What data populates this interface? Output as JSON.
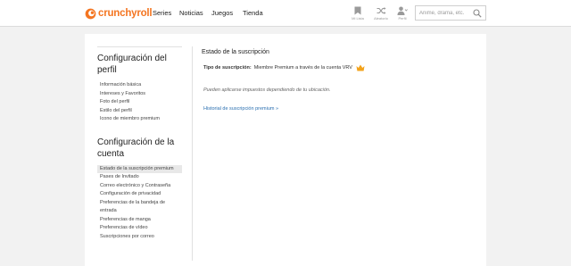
{
  "header": {
    "brand": "crunchyroll",
    "nav": [
      "Series",
      "Noticias",
      "Juegos",
      "Tienda"
    ],
    "tools": [
      {
        "label": "Mi Lista",
        "icon": "bookmark-icon"
      },
      {
        "label": "Aleatorio",
        "icon": "shuffle-icon"
      },
      {
        "label": "Perfil",
        "icon": "user-icon"
      }
    ],
    "search": {
      "placeholder": "Anime, drama, etc.",
      "value": ""
    }
  },
  "sidebar": {
    "profile_title": "Configuración del perfil",
    "profile_items": [
      "Información básica",
      "Intereses y Favoritos",
      "Foto del perfil",
      "Estilo del perfil",
      "Icono de miembro premium"
    ],
    "account_title": "Configuración de la cuenta",
    "account_items": [
      "Estado de la suscripción premium",
      "Pases de Invitado",
      "Correo electrónico y Contraseña",
      "Configuración de privacidad",
      "Preferencias de la bandeja de entrada",
      "Preferencias de manga",
      "Preferencias de vídeo",
      "Suscripciones por correo"
    ],
    "active_item": "Estado de la suscripción premium"
  },
  "main": {
    "title": "Estado de la suscripción",
    "subscription_label": "Tipo de suscripción:",
    "subscription_value": "Miembre Premium a través de la cuenta VRV",
    "tax_note": "Pueden aplicarse impuestos dependiendo de tu ubicación.",
    "history_link": "Historial de suscripción premium »"
  },
  "colors": {
    "brand": "#f47521",
    "link": "#2a6fb0",
    "crown": "#f3a31c"
  }
}
